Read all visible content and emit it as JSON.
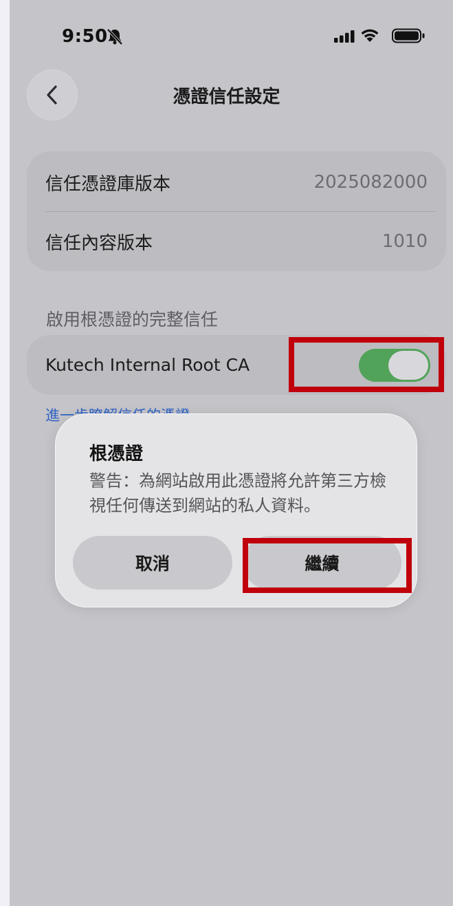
{
  "status_bar": {
    "time": "9:50",
    "icons": [
      "bell-slash-icon",
      "signal-icon",
      "wifi-icon",
      "battery-icon"
    ]
  },
  "nav": {
    "back_icon": "chevron-left-icon",
    "title": "憑證信任設定"
  },
  "versions": {
    "rows": [
      {
        "label": "信任憑證庫版本",
        "value": "2025082000"
      },
      {
        "label": "信任內容版本",
        "value": "1010"
      }
    ]
  },
  "trust": {
    "header": "啟用根憑證的完整信任",
    "certificate": "Kutech Internal Root CA",
    "enabled": true,
    "learn_more": "進一步瞭解信任的憑證"
  },
  "alert": {
    "title": "根憑證",
    "message": "警告：為網站啟用此憑證將允許第三方檢視任何傳送到網站的私人資料。",
    "cancel_label": "取消",
    "continue_label": "繼續"
  },
  "colors": {
    "toggle_on": "#52a35a",
    "link": "#2f63c4",
    "highlight": "#c0000a"
  }
}
